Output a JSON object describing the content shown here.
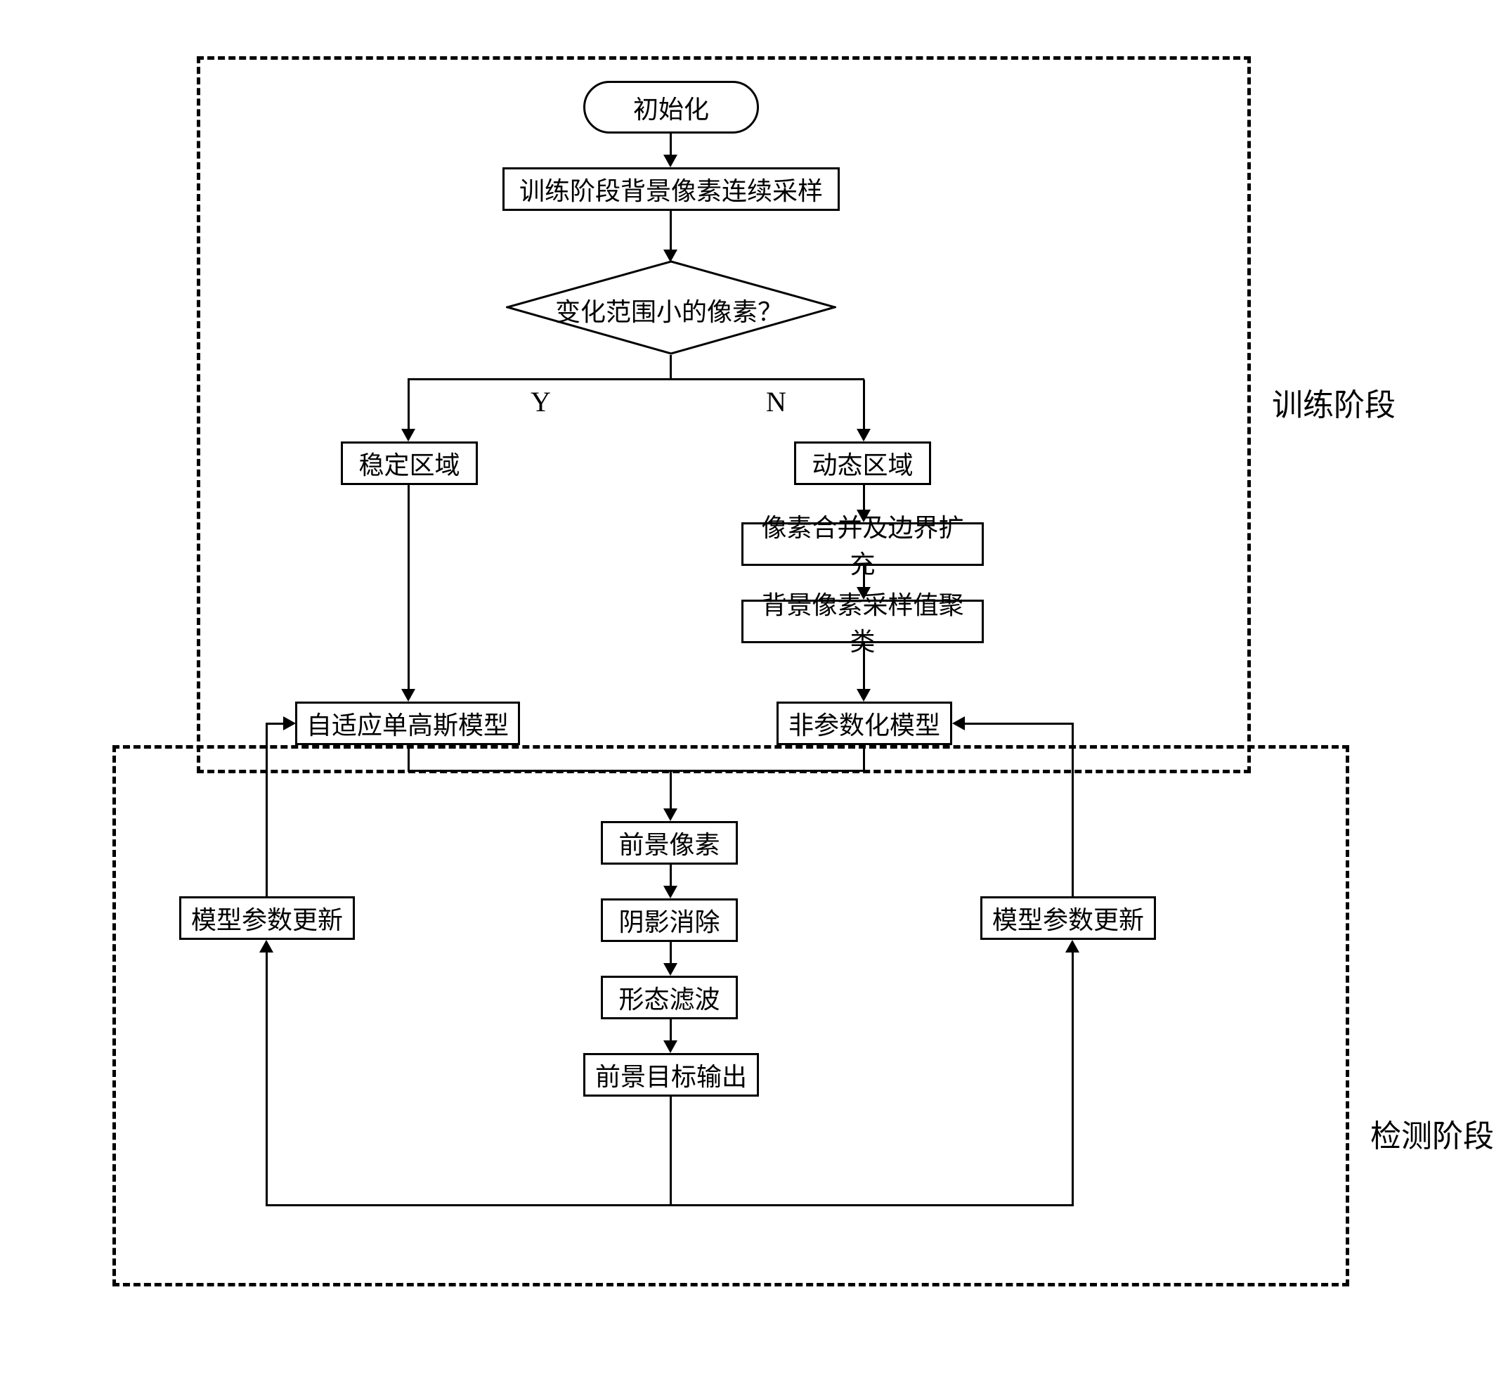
{
  "phases": {
    "training_label": "训练阶段",
    "detection_label": "检测阶段"
  },
  "nodes": {
    "init": "初始化",
    "sampling": "训练阶段背景像素连续采样",
    "decision": "变化范围小的像素？",
    "decision_y": "Y",
    "decision_n": "N",
    "stable_region": "稳定区域",
    "dynamic_region": "动态区域",
    "pixel_merge": "像素合并及边界扩充",
    "clustering": "背景像素采样值聚类",
    "adaptive_gaussian": "自适应单高斯模型",
    "nonparametric": "非参数化模型",
    "foreground_pixel": "前景像素",
    "shadow_remove": "阴影消除",
    "morphological": "形态滤波",
    "output": "前景目标输出",
    "param_update_left": "模型参数更新",
    "param_update_right": "模型参数更新"
  },
  "chart_data": {
    "type": "flowchart",
    "phases": [
      {
        "name": "训练阶段",
        "contains": [
          "init",
          "sampling",
          "decision",
          "stable_region",
          "dynamic_region",
          "pixel_merge",
          "clustering",
          "adaptive_gaussian",
          "nonparametric"
        ]
      },
      {
        "name": "检测阶段",
        "contains": [
          "foreground_pixel",
          "shadow_remove",
          "morphological",
          "output",
          "param_update_left",
          "param_update_right"
        ]
      }
    ],
    "edges": [
      {
        "from": "init",
        "to": "sampling"
      },
      {
        "from": "sampling",
        "to": "decision"
      },
      {
        "from": "decision",
        "to": "stable_region",
        "label": "Y"
      },
      {
        "from": "decision",
        "to": "dynamic_region",
        "label": "N"
      },
      {
        "from": "stable_region",
        "to": "adaptive_gaussian"
      },
      {
        "from": "dynamic_region",
        "to": "pixel_merge"
      },
      {
        "from": "pixel_merge",
        "to": "clustering"
      },
      {
        "from": "clustering",
        "to": "nonparametric"
      },
      {
        "from": "adaptive_gaussian",
        "to": "foreground_pixel"
      },
      {
        "from": "nonparametric",
        "to": "foreground_pixel"
      },
      {
        "from": "foreground_pixel",
        "to": "shadow_remove"
      },
      {
        "from": "shadow_remove",
        "to": "morphological"
      },
      {
        "from": "morphological",
        "to": "output"
      },
      {
        "from": "output",
        "to": "param_update_left"
      },
      {
        "from": "output",
        "to": "param_update_right"
      },
      {
        "from": "param_update_left",
        "to": "adaptive_gaussian"
      },
      {
        "from": "param_update_right",
        "to": "nonparametric"
      }
    ]
  }
}
